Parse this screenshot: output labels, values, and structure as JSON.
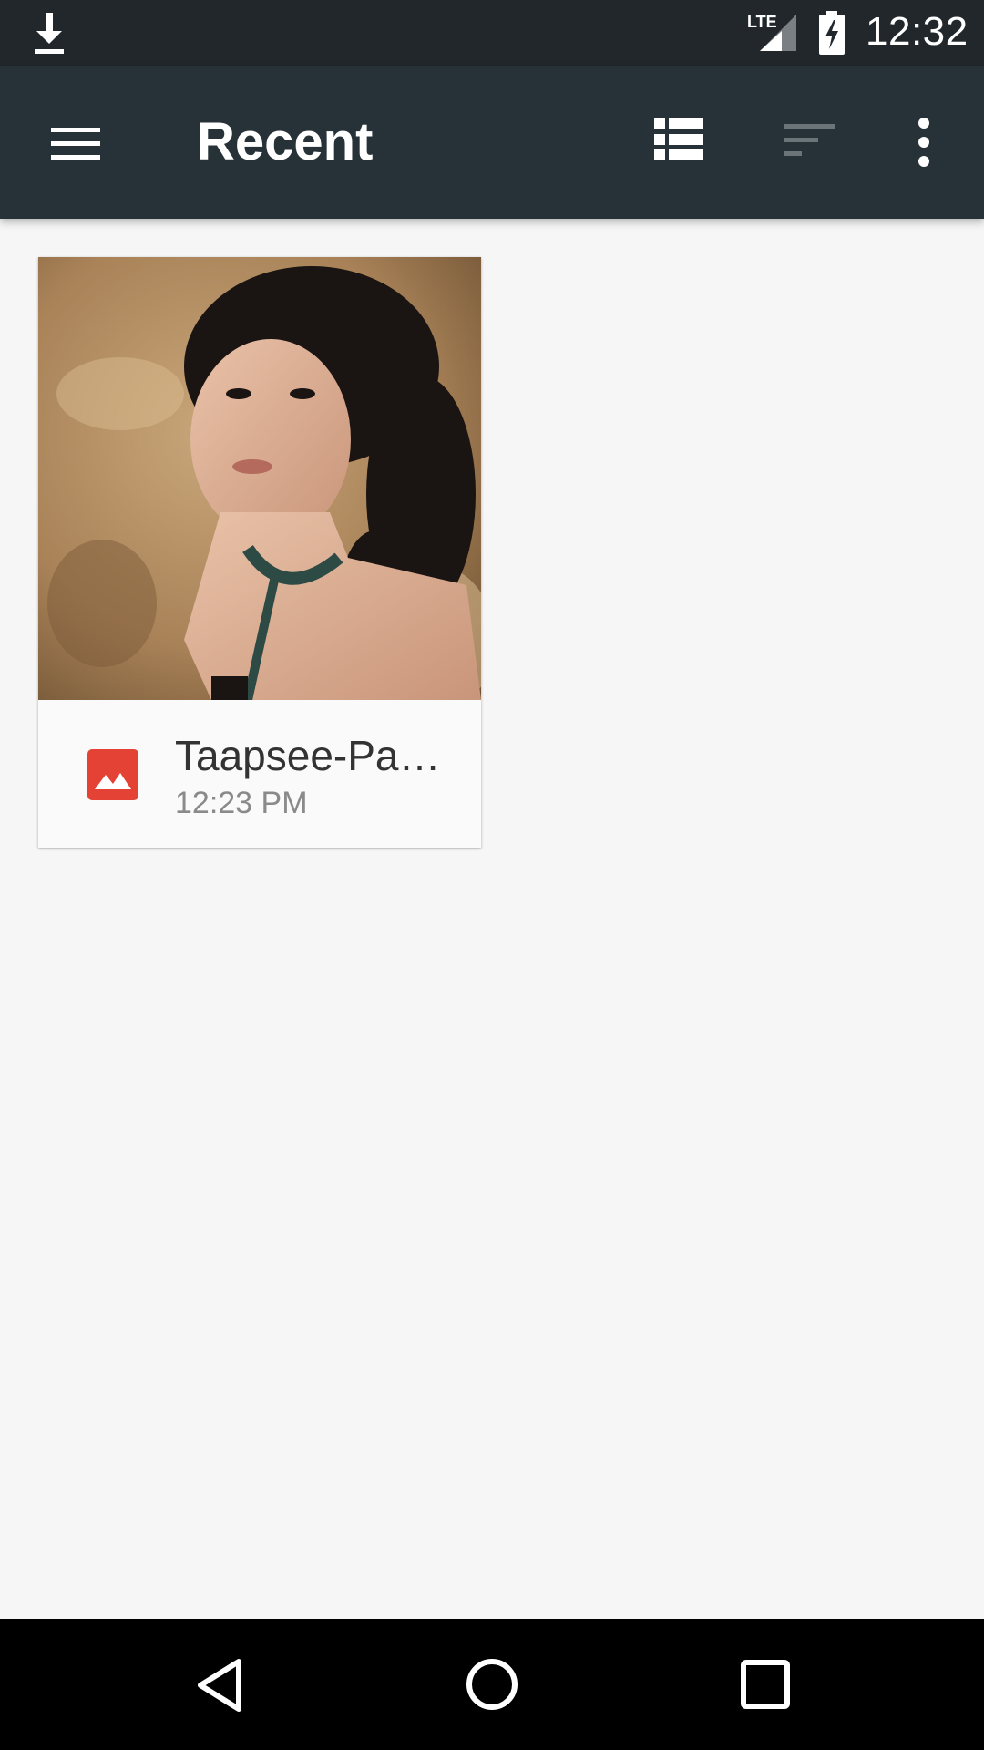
{
  "status_bar": {
    "time": "12:32",
    "network": "LTE",
    "icons": [
      "download-icon",
      "lte-signal-icon",
      "battery-charging-icon"
    ]
  },
  "toolbar": {
    "title": "Recent",
    "icons": [
      "menu-icon",
      "grid-view-icon",
      "sort-icon",
      "more-vert-icon"
    ]
  },
  "files": [
    {
      "name": "Taapsee-Pa…",
      "date": "12:23 PM",
      "type_icon": "image-file-icon",
      "type_color": "#e44234"
    }
  ],
  "colors": {
    "status_bar": "#21272b",
    "toolbar": "#263238",
    "background": "#f6f6f6",
    "sort_disabled": "#6b7478"
  },
  "nav_bar": {
    "icons": [
      "back-icon",
      "home-icon",
      "recents-icon"
    ]
  }
}
